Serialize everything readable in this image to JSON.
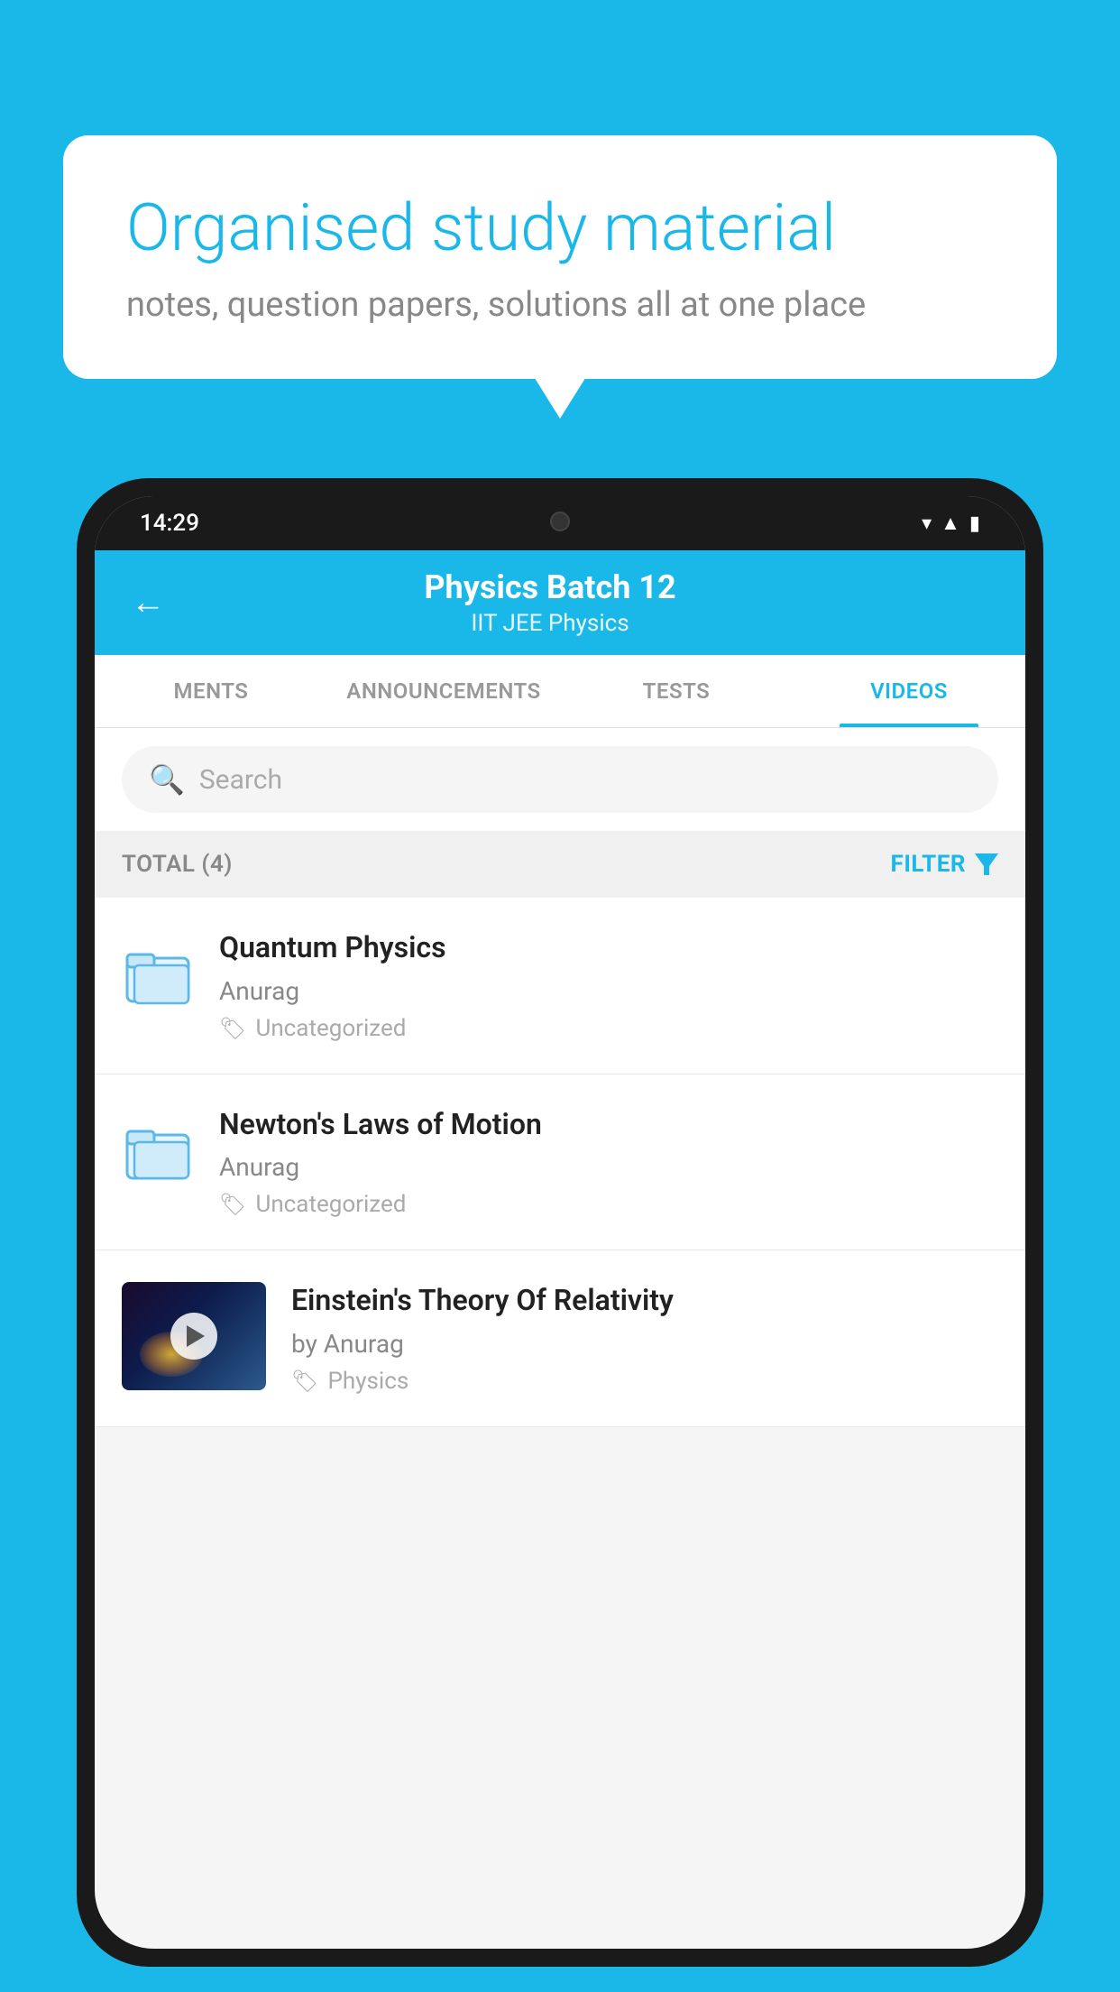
{
  "background_color": "#1ab8e8",
  "bubble": {
    "title": "Organised study material",
    "subtitle": "notes, question papers, solutions all at one place"
  },
  "phone": {
    "status_bar": {
      "time": "14:29"
    },
    "header": {
      "title": "Physics Batch 12",
      "subtitle": "IIT JEE   Physics",
      "back_label": "←"
    },
    "tabs": [
      {
        "label": "MENTS",
        "active": false
      },
      {
        "label": "ANNOUNCEMENTS",
        "active": false
      },
      {
        "label": "TESTS",
        "active": false
      },
      {
        "label": "VIDEOS",
        "active": true
      }
    ],
    "search": {
      "placeholder": "Search"
    },
    "filter_bar": {
      "total_label": "TOTAL (4)",
      "filter_label": "FILTER"
    },
    "videos": [
      {
        "id": 1,
        "title": "Quantum Physics",
        "author": "Anurag",
        "tag": "Uncategorized",
        "type": "folder",
        "has_thumbnail": false
      },
      {
        "id": 2,
        "title": "Newton's Laws of Motion",
        "author": "Anurag",
        "tag": "Uncategorized",
        "type": "folder",
        "has_thumbnail": false
      },
      {
        "id": 3,
        "title": "Einstein's Theory Of Relativity",
        "author": "by Anurag",
        "tag": "Physics",
        "type": "video",
        "has_thumbnail": true
      }
    ]
  }
}
